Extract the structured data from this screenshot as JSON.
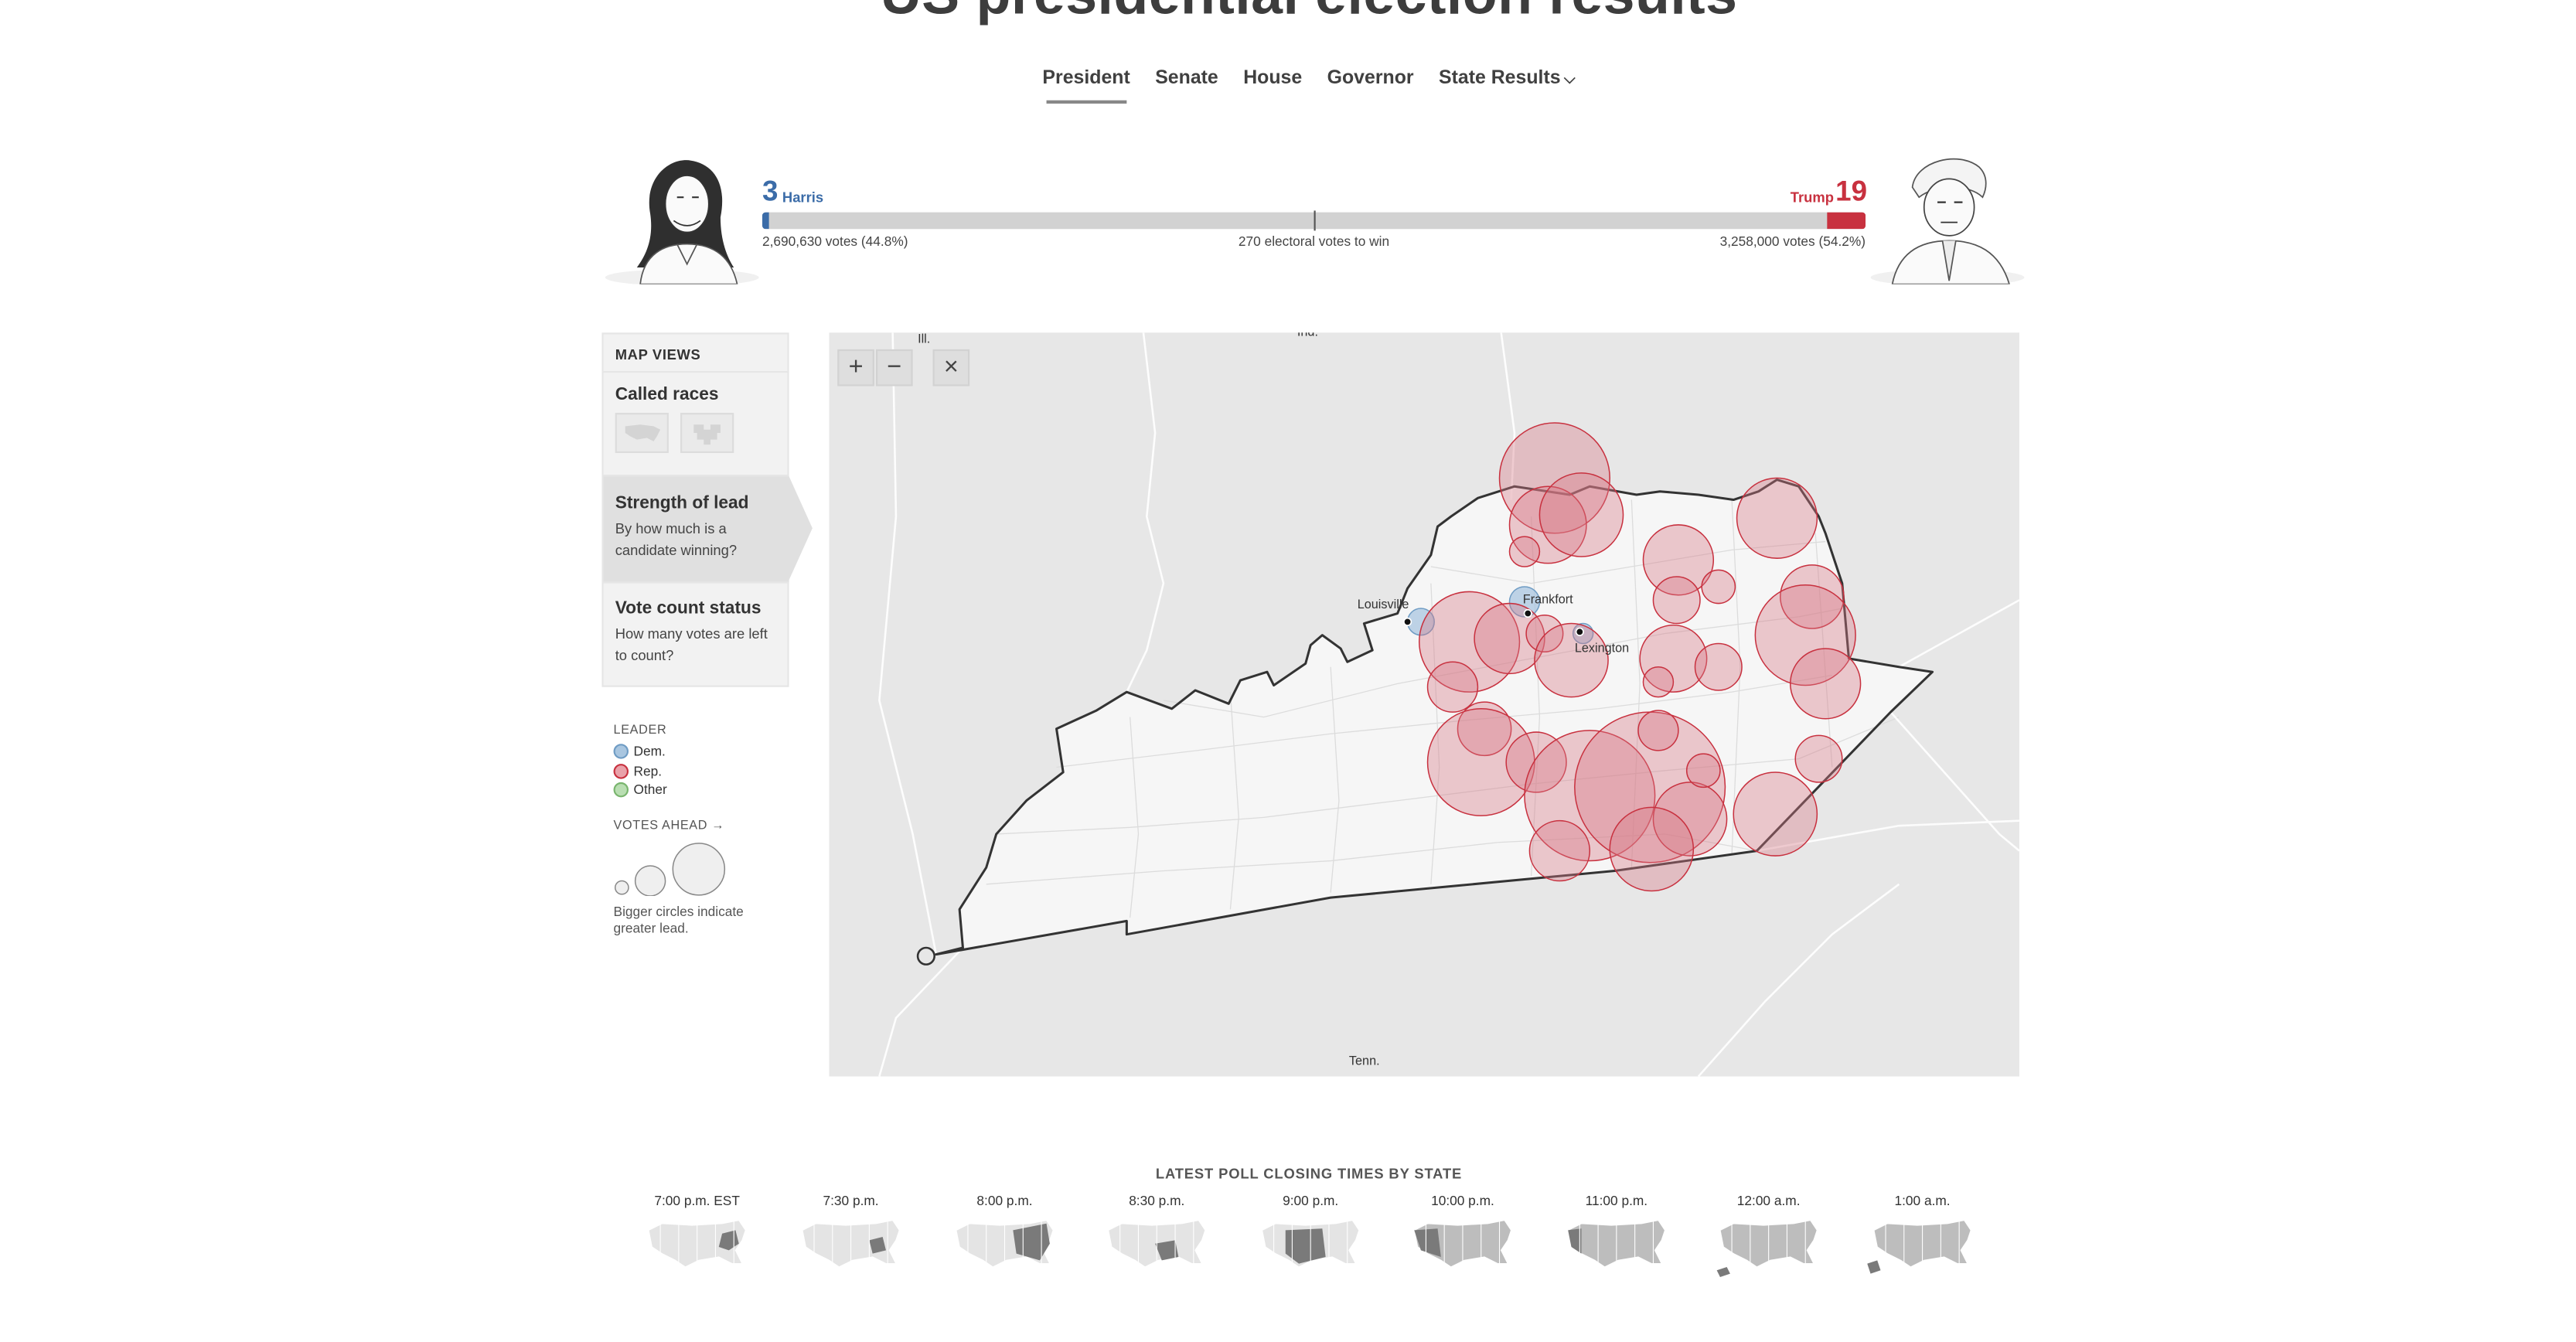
{
  "header": {
    "title": "US presidential election results"
  },
  "nav": {
    "items": [
      {
        "label": "President",
        "active": true
      },
      {
        "label": "Senate"
      },
      {
        "label": "House"
      },
      {
        "label": "Governor"
      },
      {
        "label": "State Results",
        "dropdown": true
      }
    ]
  },
  "race": {
    "harris": {
      "name": "Harris",
      "electoral_votes": "3",
      "votes_text": "2,690,630 votes (44.8%)",
      "color": "#3b6ca8"
    },
    "trump": {
      "name": "Trump",
      "electoral_votes": "19",
      "votes_text": "3,258,000 votes (54.2%)",
      "color": "#c8313f"
    },
    "win_text": "270 electoral votes to win"
  },
  "map_views": {
    "heading": "MAP VIEWS",
    "called": {
      "title": "Called races"
    },
    "strength": {
      "title": "Strength of lead",
      "desc": "By how much is a candidate winning?"
    },
    "count": {
      "title": "Vote count status",
      "desc": "How many votes are left to count?"
    }
  },
  "legend": {
    "leader_heading": "LEADER",
    "dem": "Dem.",
    "rep": "Rep.",
    "other": "Other",
    "votes_ahead_heading": "VOTES AHEAD →",
    "note": "Bigger circles indicate greater lead.",
    "colors": {
      "dem": "#a9c6e0",
      "rep": "#e9a2aa",
      "other": "#b9deb2"
    }
  },
  "map": {
    "labels": {
      "ill": "Ill.",
      "ind": "Ind.",
      "tenn": "Tenn.",
      "louisville": "Louisville",
      "frankfort": "Frankfort",
      "lexington": "Lexington"
    },
    "controls": {
      "zoom_in": "+",
      "zoom_out": "−",
      "reset": "×"
    }
  },
  "poll_closing": {
    "title": "LATEST POLL CLOSING TIMES BY STATE",
    "times": [
      "7:00 p.m. EST",
      "7:30 p.m.",
      "8:00 p.m.",
      "8:30 p.m.",
      "9:00 p.m.",
      "10:00 p.m.",
      "11:00 p.m.",
      "12:00 a.m.",
      "1:00 a.m."
    ]
  }
}
